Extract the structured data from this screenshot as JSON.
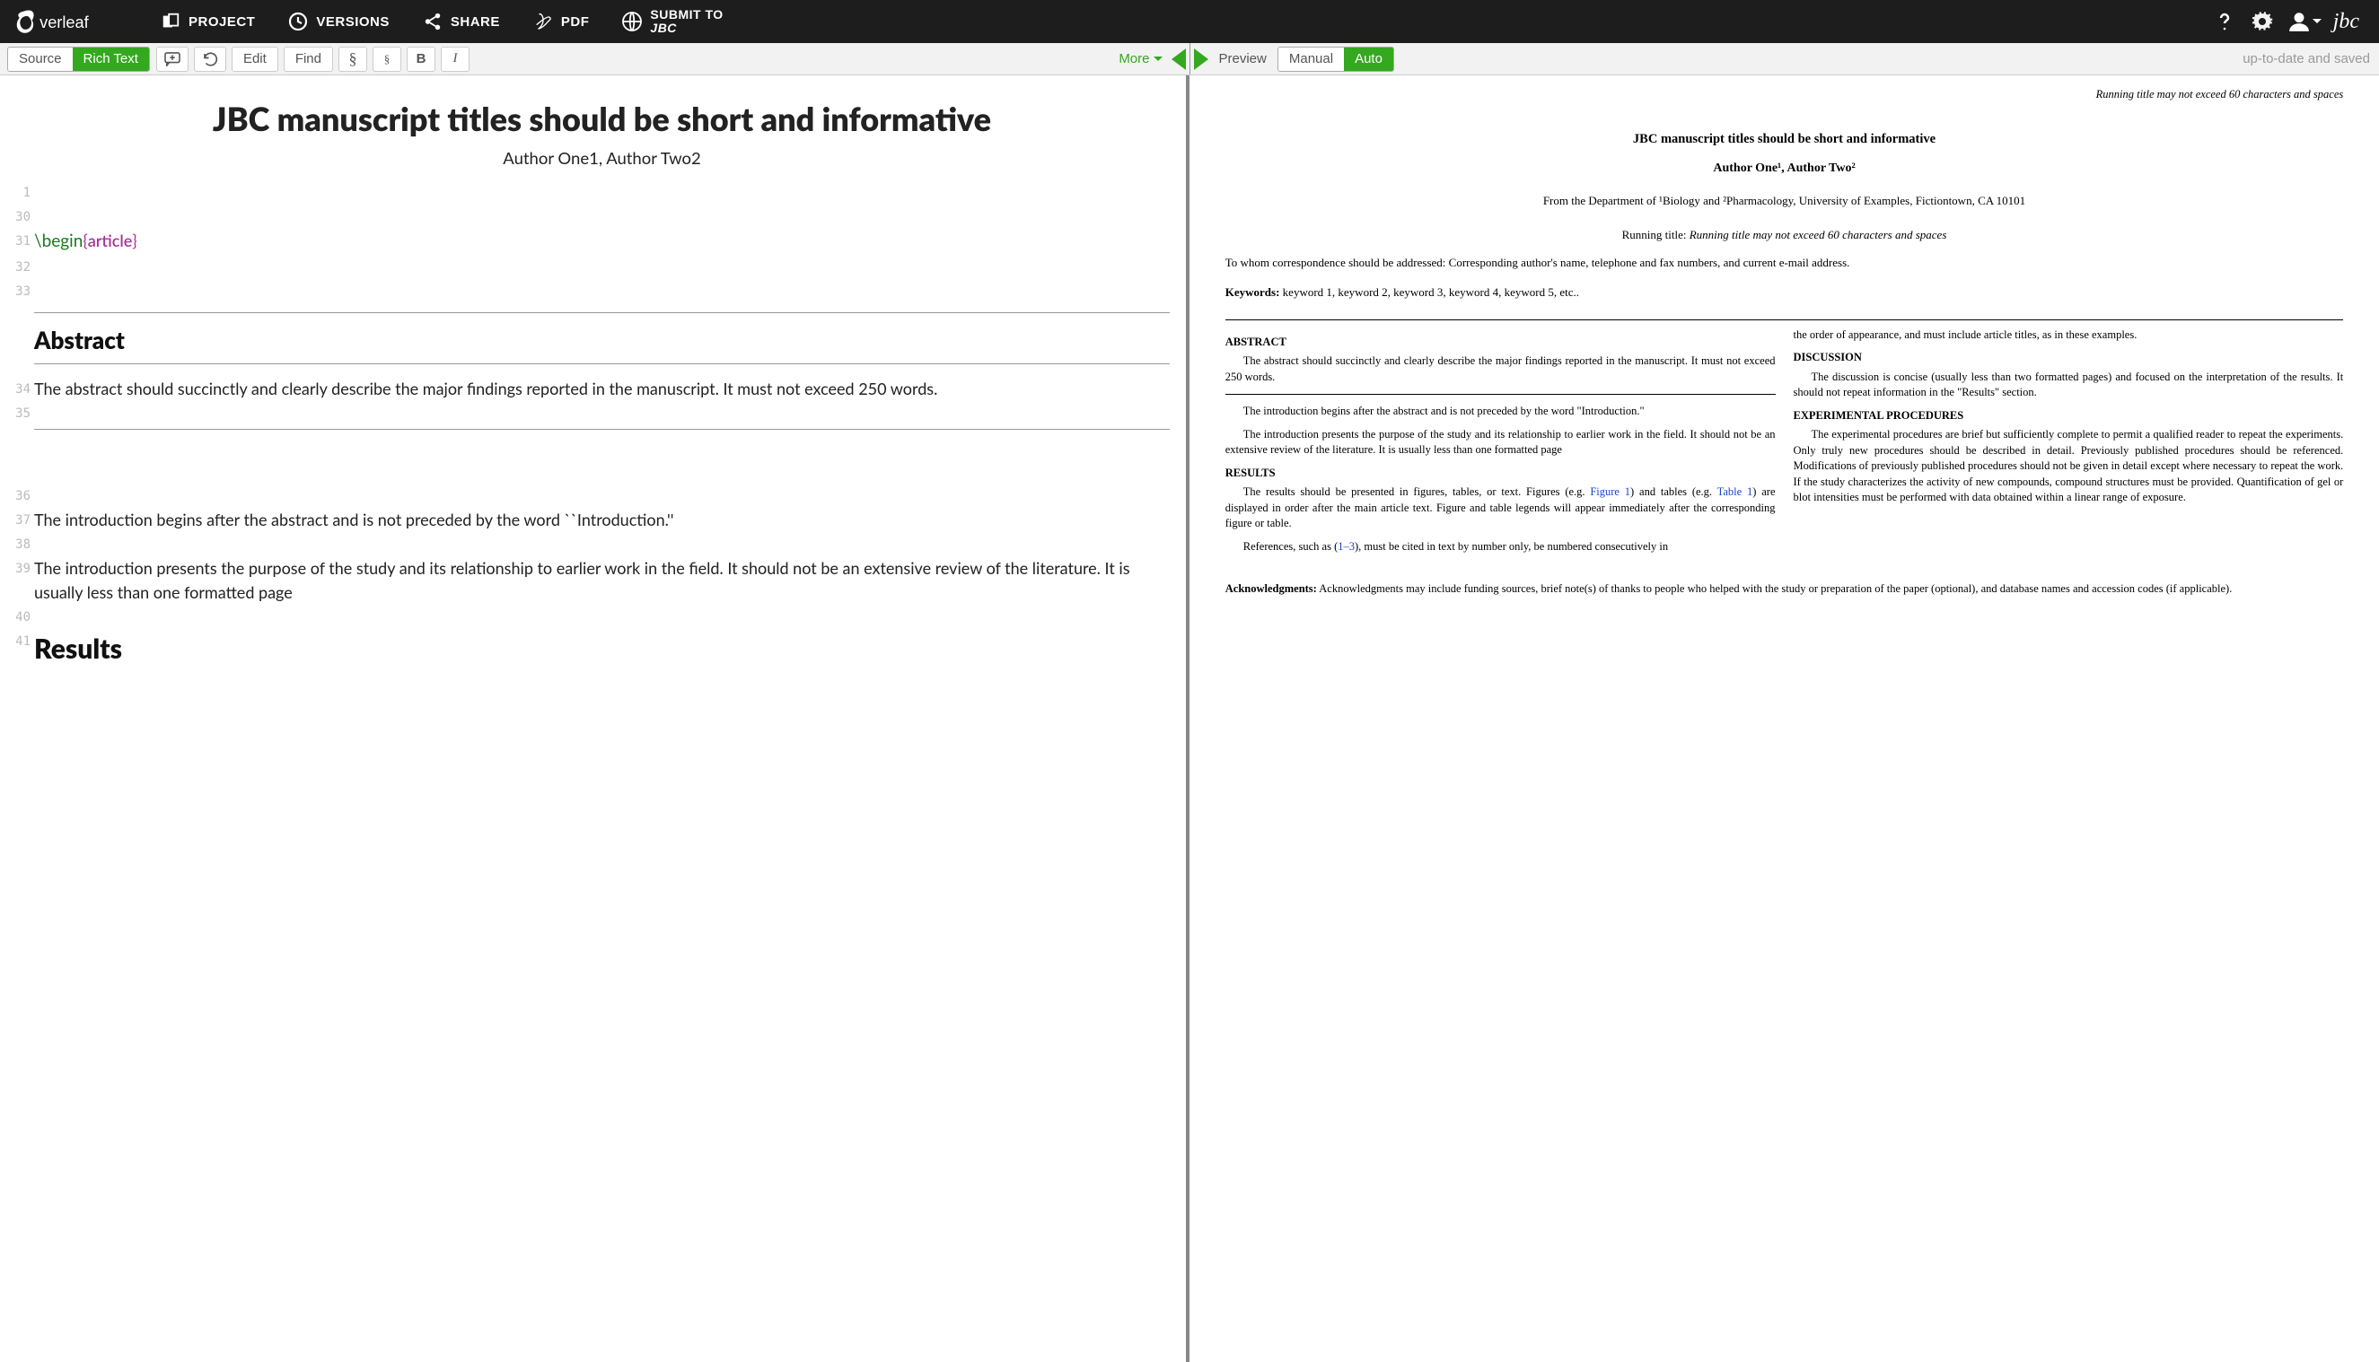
{
  "brand": "Overleaf",
  "nav": {
    "project": "PROJECT",
    "versions": "VERSIONS",
    "share": "SHARE",
    "pdf": "PDF",
    "submit_l1": "SUBMIT TO",
    "submit_l2": "JBC"
  },
  "journal_link": "jbc",
  "toolbar": {
    "source": "Source",
    "rich_text": "Rich Text",
    "edit": "Edit",
    "find": "Find",
    "section": "§",
    "subsection": "§",
    "bold": "B",
    "italic": "I",
    "more": "More",
    "preview": "Preview",
    "manual": "Manual",
    "auto": "Auto",
    "status": "up-to-date and saved"
  },
  "editor": {
    "title": "JBC manuscript titles should be short and informative",
    "authors": "Author One1, Author Two2",
    "lines": {
      "l1": "1",
      "l30": "30",
      "l31": "31",
      "l32": "32",
      "l33": "33",
      "l34": "34",
      "l35": "35",
      "l36": "36",
      "l37": "37",
      "l38": "38",
      "l39": "39",
      "l40": "40",
      "l41": "41"
    },
    "begin_cmd": "\\begin",
    "begin_env": "article",
    "h_abstract": "Abstract",
    "p34": "The abstract should succinctly and clearly describe the major findings reported in the manuscript. It must not exceed 250 words.",
    "p37": "The introduction begins after the abstract and is not preceded by the word ``Introduction.''",
    "p39": "The introduction presents the purpose of the study and its relationship to earlier work in the field. It should not be an extensive review of the literature. It is usually less than one formatted page",
    "h_results": "Results"
  },
  "pdf": {
    "running_note": "Running title may not exceed 60 characters and spaces",
    "title": "JBC manuscript titles should be short and informative",
    "authors_html": "Author One¹, Author Two²",
    "from": "From the Department of ¹Biology and ²Pharmacology, University of Examples, Fictiontown, CA 10101",
    "running_label": "Running title:",
    "running_value": "Running title may not exceed 60 characters and spaces",
    "corr": "To whom correspondence should be addressed: Corresponding author's name, telephone and fax numbers, and current e-mail address.",
    "kw_label": "Keywords:",
    "kw_value": "keyword 1, keyword 2, keyword 3, keyword 4, keyword 5, etc..",
    "col1": {
      "h_abstract": "ABSTRACT",
      "p_abstract": "The abstract should succinctly and clearly describe the major findings reported in the manuscript. It must not exceed 250 words.",
      "p_intro1": "The introduction begins after the abstract and is not preceded by the word \"Introduction.\"",
      "p_intro2": "The introduction presents the purpose of the study and its relationship to earlier work in the field. It should not be an extensive review of the literature. It is usually less than one formatted page",
      "h_results": "RESULTS",
      "p_results_a": "The results should be presented in figures, tables, or text. Figures (e.g. ",
      "fig1": "Figure 1",
      "p_results_b": ") and tables (e.g. ",
      "tab1": "Table 1",
      "p_results_c": ") are displayed in order after the main article text. Figure and table legends will appear immediately after the corresponding figure or table.",
      "p_refs_a": "References, such as (",
      "refs": "1–3",
      "p_refs_b": "), must be cited in text by number only, be numbered consecutively in"
    },
    "col2": {
      "p_cont": "the order of appearance, and must include article titles, as in these examples.",
      "h_discussion": "DISCUSSION",
      "p_discussion": "The discussion is concise (usually less than two formatted pages) and focused on the interpretation of the results. It should not repeat information in the \"Results\" section.",
      "h_exp": "EXPERIMENTAL PROCEDURES",
      "p_exp": "The experimental procedures are brief but sufficiently complete to permit a qualified reader to repeat the experiments. Only truly new procedures should be described in detail. Previously published procedures should be referenced. Modifications of previously published procedures should not be given in detail except where necessary to repeat the work. If the study characterizes the activity of new compounds, compound structures must be provided. Quantification of gel or blot intensities must be performed with data obtained within a linear range of exposure."
    },
    "ack_label": "Acknowledgments:",
    "ack": "Acknowledgments may include funding sources, brief note(s) of thanks to people who helped with the study or preparation of the paper (optional), and database names and accession codes (if applicable)."
  }
}
